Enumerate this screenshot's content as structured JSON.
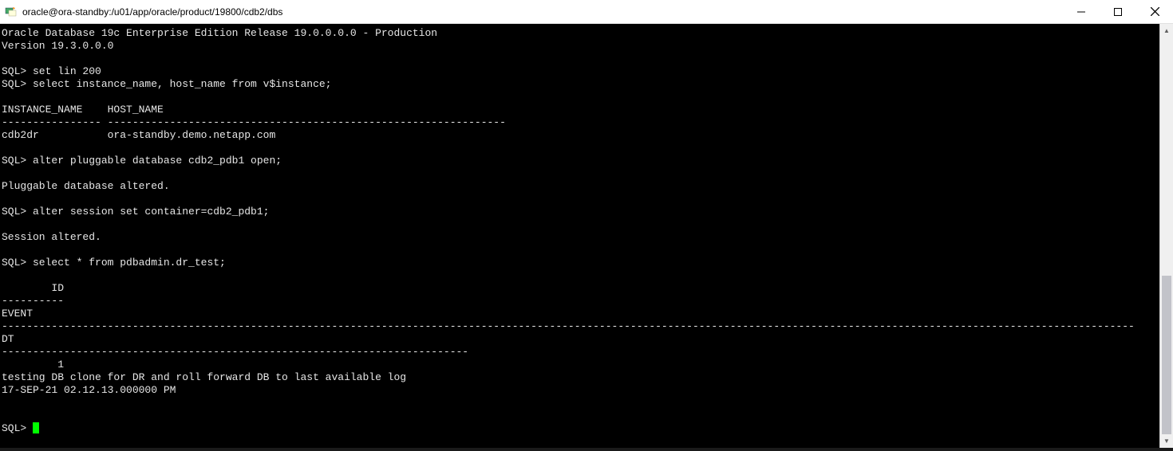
{
  "window": {
    "title": "oracle@ora-standby:/u01/app/oracle/product/19800/cdb2/dbs"
  },
  "terminal": {
    "lines": [
      "Oracle Database 19c Enterprise Edition Release 19.0.0.0.0 - Production",
      "Version 19.3.0.0.0",
      "",
      "SQL> set lin 200",
      "SQL> select instance_name, host_name from v$instance;",
      "",
      "INSTANCE_NAME    HOST_NAME",
      "---------------- ----------------------------------------------------------------",
      "cdb2dr           ora-standby.demo.netapp.com",
      "",
      "SQL> alter pluggable database cdb2_pdb1 open;",
      "",
      "Pluggable database altered.",
      "",
      "SQL> alter session set container=cdb2_pdb1;",
      "",
      "Session altered.",
      "",
      "SQL> select * from pdbadmin.dr_test;",
      "",
      "        ID",
      "----------",
      "EVENT",
      "--------------------------------------------------------------------------------------------------------------------------------------------------------------------------------------",
      "DT",
      "---------------------------------------------------------------------------",
      "         1",
      "testing DB clone for DR and roll forward DB to last available log",
      "17-SEP-21 02.12.13.000000 PM",
      "",
      ""
    ],
    "prompt": "SQL> "
  }
}
